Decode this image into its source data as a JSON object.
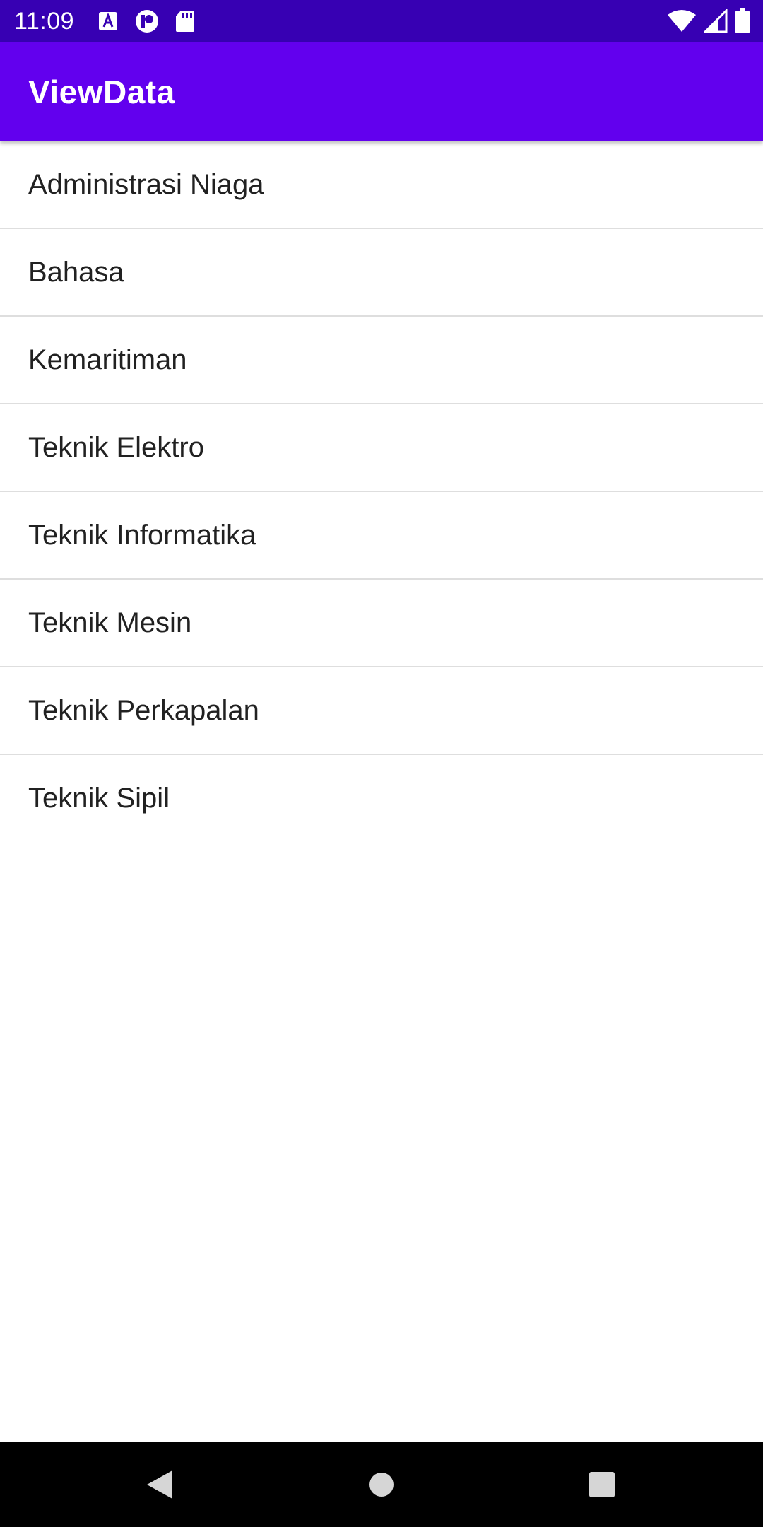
{
  "status_bar": {
    "time": "11:09",
    "left_icons": [
      "text-a-icon",
      "record-icon",
      "sd-card-icon"
    ],
    "right_icons": [
      "wifi-icon",
      "cell-signal-icon",
      "battery-icon"
    ],
    "background": "#3700b3"
  },
  "app_bar": {
    "title": "ViewData",
    "background": "#6200ee"
  },
  "list": {
    "items": [
      {
        "label": "Administrasi Niaga"
      },
      {
        "label": "Bahasa"
      },
      {
        "label": "Kemaritiman"
      },
      {
        "label": "Teknik Elektro"
      },
      {
        "label": "Teknik Informatika"
      },
      {
        "label": "Teknik Mesin"
      },
      {
        "label": "Teknik Perkapalan"
      },
      {
        "label": "Teknik Sipil"
      }
    ]
  },
  "nav_bar": {
    "buttons": [
      "back-icon",
      "home-icon",
      "recents-icon"
    ]
  }
}
